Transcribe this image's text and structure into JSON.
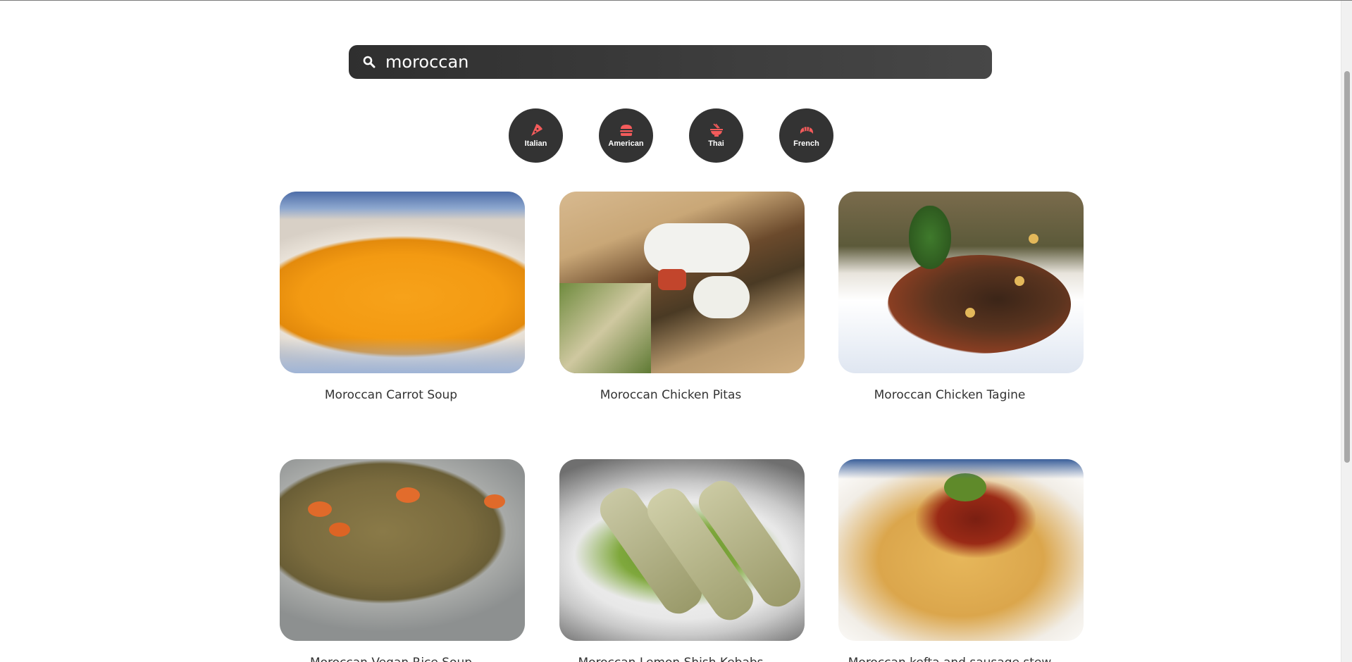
{
  "search": {
    "value": "moroccan",
    "placeholder": ""
  },
  "categories": [
    {
      "label": "Italian",
      "icon": "pizza-icon"
    },
    {
      "label": "American",
      "icon": "hamburger-icon"
    },
    {
      "label": "Thai",
      "icon": "bowl-icon"
    },
    {
      "label": "French",
      "icon": "croissant-icon"
    }
  ],
  "recipes": [
    {
      "title": "Moroccan Carrot Soup"
    },
    {
      "title": "Moroccan Chicken Pitas"
    },
    {
      "title": "Moroccan Chicken Tagine"
    },
    {
      "title": "Moroccan Vegan Rice Soup"
    },
    {
      "title": "Moroccan Lemon Shish Kebabs"
    },
    {
      "title": "Moroccan kefta and sausage stew"
    }
  ],
  "colors": {
    "accent": "#f45b5b",
    "button_bg": "#333333",
    "search_bg": "#3a3a3a"
  }
}
